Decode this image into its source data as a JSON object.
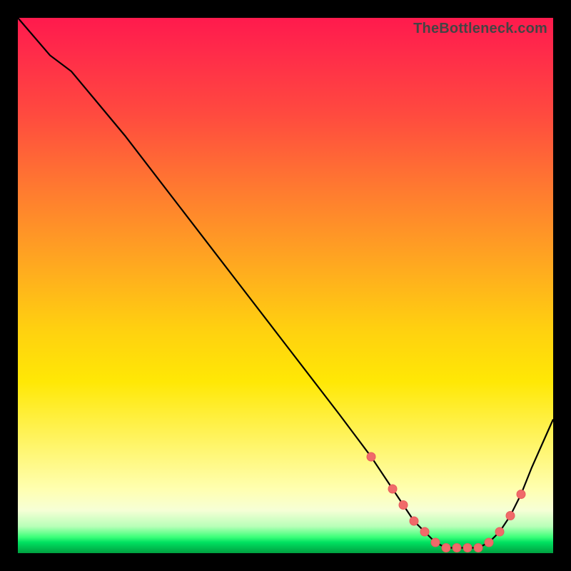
{
  "watermark": "TheBottleneck.com",
  "colors": {
    "frame_bg": "#000000",
    "curve_stroke": "#000000",
    "marker_fill": "#f06a6a",
    "marker_stroke": "#e85c5c"
  },
  "chart_data": {
    "type": "line",
    "title": "",
    "xlabel": "",
    "ylabel": "",
    "xlim": [
      0,
      100
    ],
    "ylim": [
      0,
      100
    ],
    "series": [
      {
        "name": "bottleneck-curve",
        "x": [
          0,
          6,
          10,
          20,
          30,
          40,
          50,
          60,
          66,
          70,
          72,
          74,
          76,
          78,
          80,
          82,
          84,
          86,
          88,
          90,
          92,
          94,
          96,
          100
        ],
        "y": [
          100,
          93,
          90,
          78,
          65,
          52,
          39,
          26,
          18,
          12,
          9,
          6,
          4,
          2,
          1,
          1,
          1,
          1,
          2,
          4,
          7,
          11,
          16,
          25
        ]
      }
    ],
    "markers": {
      "name": "highlight-points",
      "x": [
        66,
        70,
        72,
        74,
        76,
        78,
        80,
        82,
        84,
        86,
        88,
        90,
        92,
        94
      ],
      "y": [
        18,
        12,
        9,
        6,
        4,
        2,
        1,
        1,
        1,
        1,
        2,
        4,
        7,
        11
      ]
    }
  }
}
